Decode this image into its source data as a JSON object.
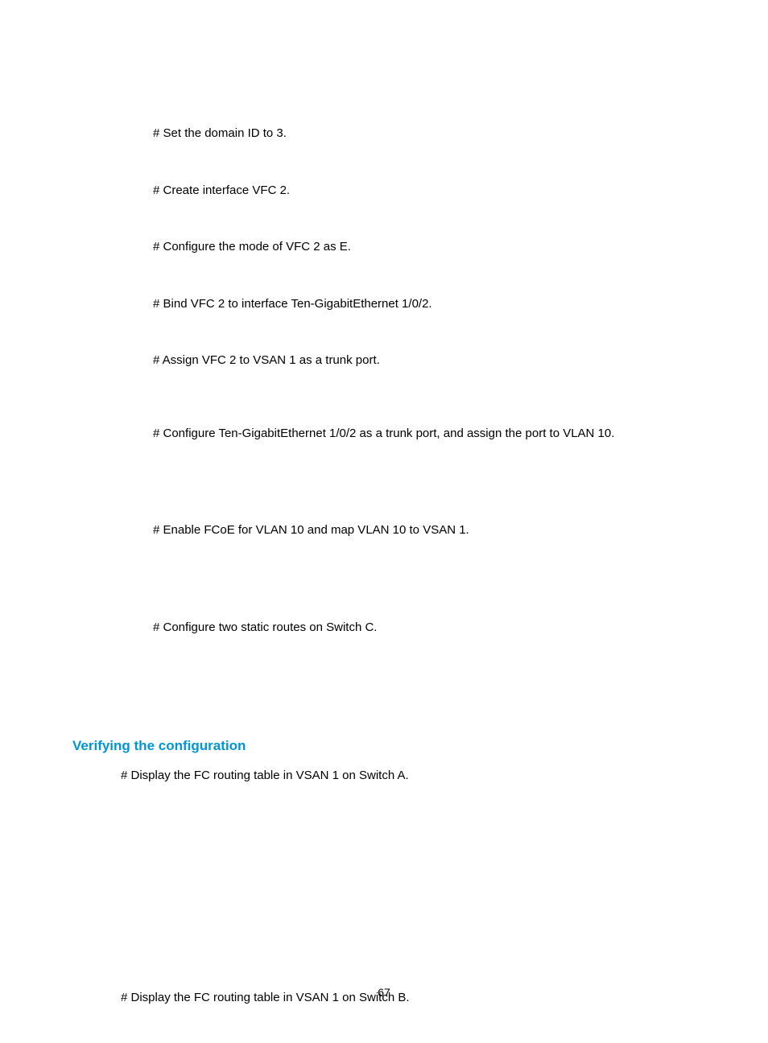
{
  "instructions": {
    "set_domain_id": "# Set the domain ID to 3.",
    "create_vfc2": "# Create interface VFC 2.",
    "configure_mode": "# Configure the mode of VFC 2 as E.",
    "bind_vfc2": "# Bind VFC 2 to interface Ten-GigabitEthernet 1/0/2.",
    "assign_vfc2": "# Assign VFC 2 to VSAN 1 as a trunk port.",
    "configure_trunk": "# Configure Ten-GigabitEthernet 1/0/2 as a trunk port, and assign the port to VLAN 10.",
    "enable_fcoe": "# Enable FCoE for VLAN 10 and map VLAN 10 to VSAN 1.",
    "configure_routes": "# Configure two static routes on Switch C.",
    "display_switch_a": "# Display the FC routing table in VSAN 1 on Switch A.",
    "display_switch_b": "# Display the FC routing table in VSAN 1 on Switch B."
  },
  "section_heading": "Verifying the configuration",
  "page_number": "67"
}
